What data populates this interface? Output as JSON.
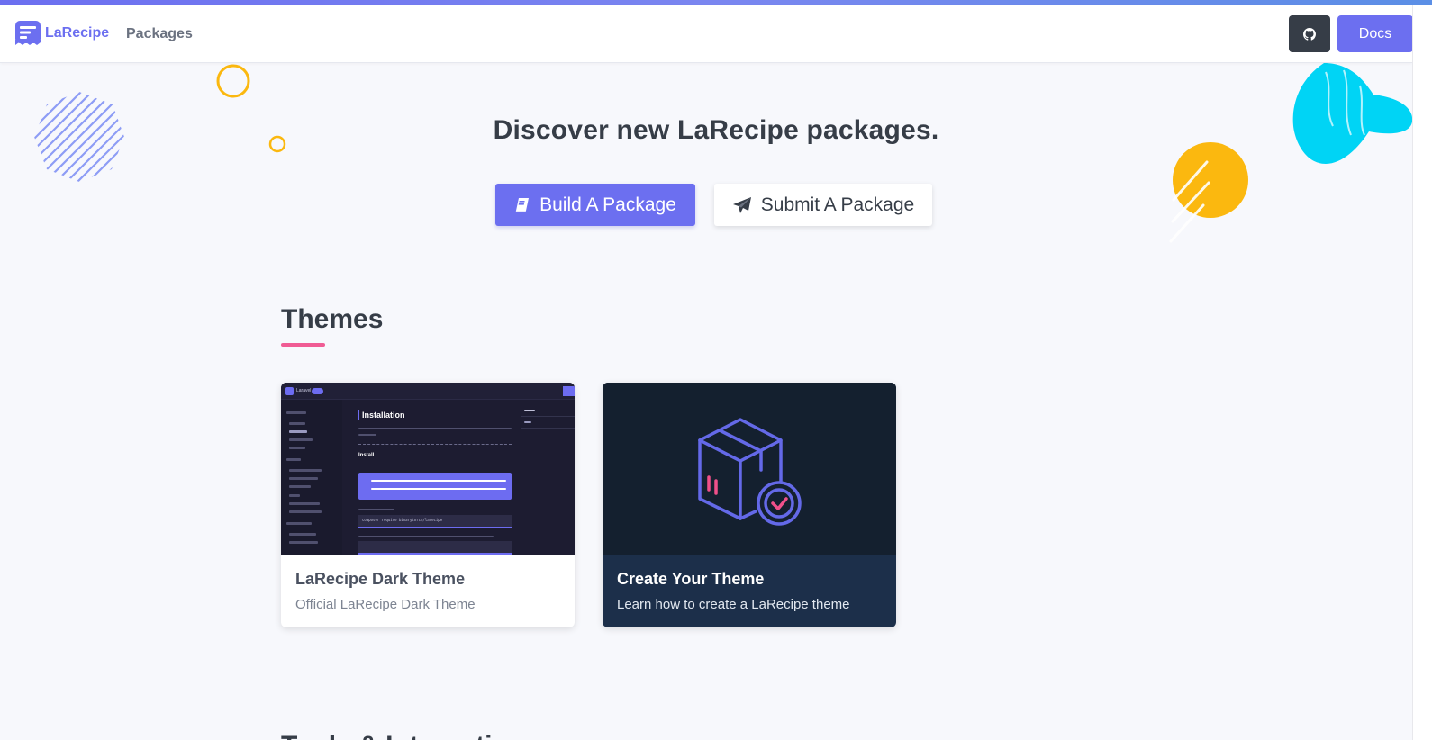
{
  "brand": {
    "name": "LaRecipe"
  },
  "nav": {
    "packages_label": "Packages",
    "docs_label": "Docs"
  },
  "hero": {
    "title": "Discover new LaRecipe packages.",
    "build_label": "Build A Package",
    "submit_label": "Submit A Package"
  },
  "themes": {
    "heading": "Themes",
    "cards": [
      {
        "title": "LaRecipe Dark Theme",
        "description": "Official LaRecipe Dark Theme"
      },
      {
        "title": "Create Your Theme",
        "description": "Learn how to create a LaRecipe theme"
      }
    ]
  },
  "next_section": {
    "heading": "Tools & Integrations"
  },
  "mini_preview": {
    "brand": "Laravel",
    "heading": "Installation",
    "subheading": "Install",
    "code": "composer require binarytorch/larecipe"
  },
  "colors": {
    "accent": "#6c6ff0",
    "dark": "#363d47",
    "underline": "#f05c94",
    "card_dark": "#1c2f4a",
    "yellow": "#fbb80f",
    "cyan": "#00d4f5"
  },
  "icons": [
    "larecipe-logo-icon",
    "github-icon",
    "book-icon",
    "paper-plane-icon",
    "package-check-icon"
  ]
}
